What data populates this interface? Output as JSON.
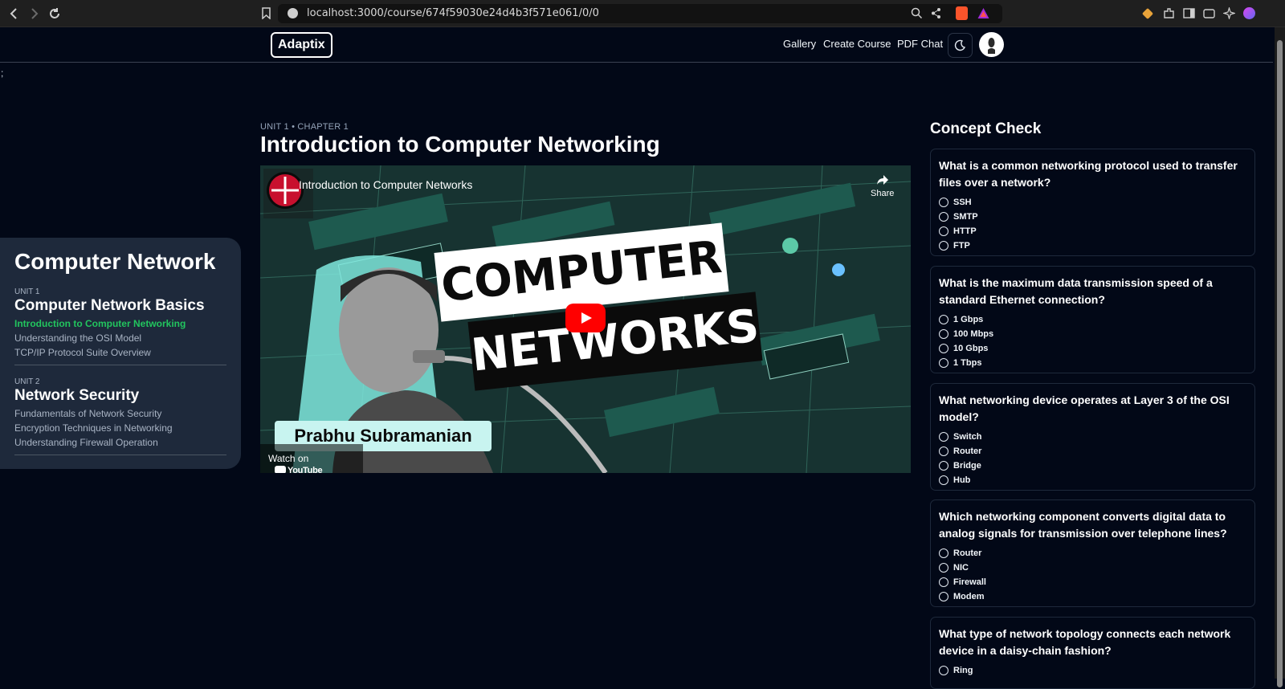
{
  "browser": {
    "url": "localhost:3000/course/674f59030e24d4b3f571e061/0/0",
    "back_icon": "chevron-left-icon",
    "forward_icon": "chevron-right-icon",
    "reload_icon": "reload-icon"
  },
  "header": {
    "logo": "Adaptix",
    "nav": [
      "Gallery",
      "Create Course",
      "PDF Chat"
    ],
    "theme_icon": "moon-icon"
  },
  "stray_text": ";",
  "sidebar": {
    "course_title": "Computer Network",
    "units": [
      {
        "label": "UNIT 1",
        "title": "Computer Network Basics",
        "chapters": [
          "Introduction to Computer Networking",
          "Understanding the OSI Model",
          "TCP/IP Protocol Suite Overview"
        ]
      },
      {
        "label": "UNIT 2",
        "title": "Network Security",
        "chapters": [
          "Fundamentals of Network Security",
          "Encryption Techniques in Networking",
          "Understanding Firewall Operation"
        ]
      }
    ]
  },
  "main": {
    "breadcrumb": "UNIT 1 • CHAPTER 1",
    "title": "Introduction to Computer Networking",
    "video": {
      "title": "Introduction to Computer Networks",
      "share": "Share",
      "banner1": "COMPUTER",
      "banner2": "NETWORKS",
      "presenter": "Prabhu Subramanian",
      "watch_on": "Watch on",
      "youtube": "YouTube"
    }
  },
  "concept_check": {
    "title": "Concept Check",
    "questions": [
      {
        "q": "What is a common networking protocol used to transfer files over a network?",
        "options": [
          "SSH",
          "SMTP",
          "HTTP",
          "FTP"
        ]
      },
      {
        "q": "What is the maximum data transmission speed of a standard Ethernet connection?",
        "options": [
          "1 Gbps",
          "100 Mbps",
          "10 Gbps",
          "1 Tbps"
        ]
      },
      {
        "q": "What networking device operates at Layer 3 of the OSI model?",
        "options": [
          "Switch",
          "Router",
          "Bridge",
          "Hub"
        ]
      },
      {
        "q": "Which networking component converts digital data to analog signals for transmission over telephone lines?",
        "options": [
          "Router",
          "NIC",
          "Firewall",
          "Modem"
        ]
      },
      {
        "q": "What type of network topology connects each network device in a daisy-chain fashion?",
        "options": [
          "Ring"
        ]
      }
    ]
  }
}
